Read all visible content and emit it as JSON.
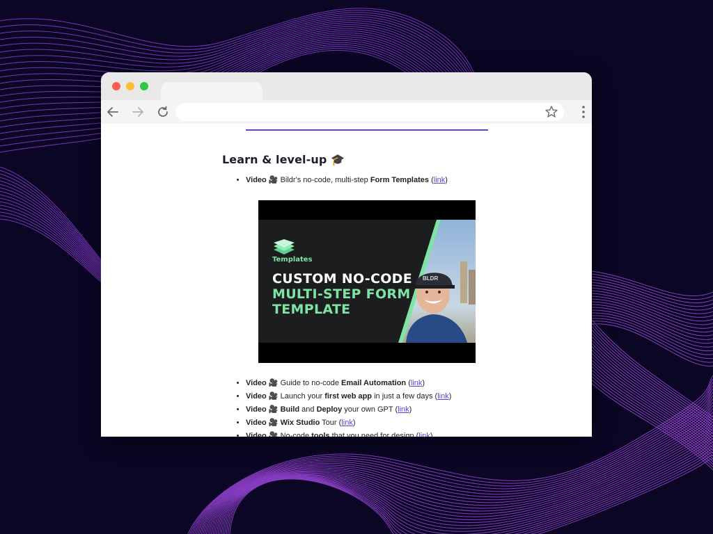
{
  "heading": "Learn & level-up 🎓",
  "items_top": [
    {
      "label": "Video",
      "emoji": "🎥",
      "parts": [
        {
          "t": " Bildr's no-code, multi-step ",
          "b": false
        },
        {
          "t": "Form Templates",
          "b": true
        },
        {
          "t": " (",
          "b": false
        }
      ],
      "link": "link",
      "tail": ")"
    }
  ],
  "video": {
    "badge": "Templates",
    "line1": "CUSTOM NO-CODE",
    "line2": "MULTI-STEP FORM",
    "line3": "TEMPLATE",
    "cap_text": "BLDR",
    "accent": "#7ee3a3"
  },
  "items": [
    {
      "label": "Video",
      "emoji": "🎥",
      "parts": [
        {
          "t": " Guide to no-code ",
          "b": false
        },
        {
          "t": "Email Automation",
          "b": true
        },
        {
          "t": " (",
          "b": false
        }
      ],
      "link": "link",
      "tail": ")"
    },
    {
      "label": "Video",
      "emoji": "🎥",
      "parts": [
        {
          "t": " Launch your ",
          "b": false
        },
        {
          "t": "first web app",
          "b": true
        },
        {
          "t": " in just a few days (",
          "b": false
        }
      ],
      "link": "link",
      "tail": ")"
    },
    {
      "label": "Video",
      "emoji": "🎥",
      "parts": [
        {
          "t": " ",
          "b": false
        },
        {
          "t": "Build",
          "b": true
        },
        {
          "t": " and ",
          "b": false
        },
        {
          "t": "Deploy",
          "b": true
        },
        {
          "t": " your own GPT (",
          "b": false
        }
      ],
      "link": "link",
      "tail": ")"
    },
    {
      "label": "Video",
      "emoji": "🎥",
      "parts": [
        {
          "t": " ",
          "b": false
        },
        {
          "t": "Wix Studio",
          "b": true
        },
        {
          "t": " Tour (",
          "b": false
        }
      ],
      "link": "link",
      "tail": ")"
    },
    {
      "label": "Video",
      "emoji": "🎥",
      "parts": [
        {
          "t": " No-code ",
          "b": false
        },
        {
          "t": "tools",
          "b": true
        },
        {
          "t": " that you need for design (",
          "b": false
        }
      ],
      "link": "link",
      "tail": ")"
    }
  ],
  "icons": {
    "back": "arrow-left-icon",
    "forward": "arrow-right-icon",
    "reload": "reload-icon",
    "bookmark": "star-icon",
    "menu": "kebab-menu-icon"
  },
  "colors": {
    "background": "#0a0624",
    "wave": "#8a3fd6",
    "divider": "#6a3fbf",
    "link": "#5a3fd3"
  }
}
